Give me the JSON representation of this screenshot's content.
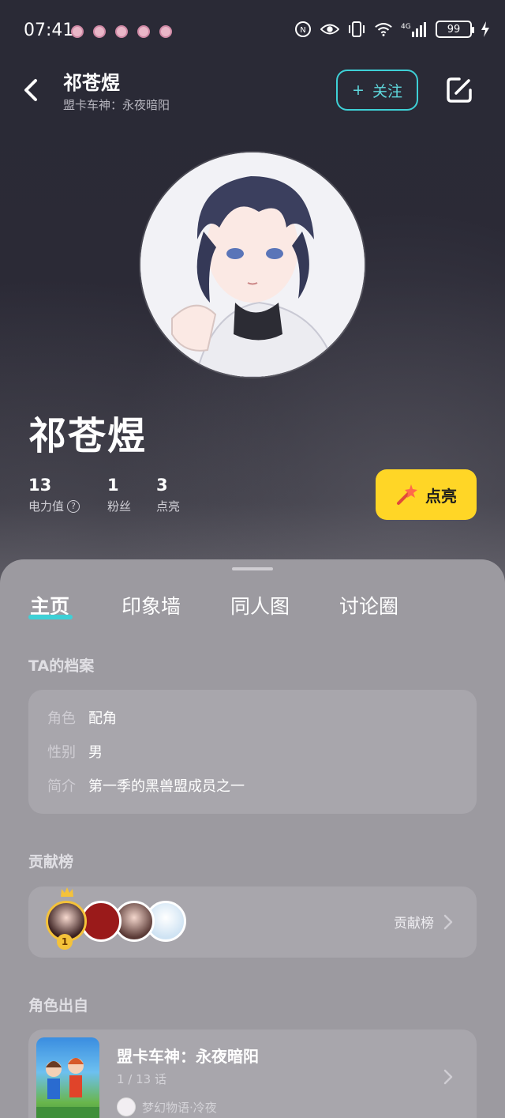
{
  "status_bar": {
    "time": "07:41",
    "battery": "99",
    "network": "4G"
  },
  "header": {
    "title": "祁苍煜",
    "subtitle": "盟卡车神：永夜暗阳",
    "follow_label": "关注",
    "follow_plus": "+"
  },
  "profile": {
    "name": "祁苍煜",
    "stats": [
      {
        "value": "13",
        "label": "电力值"
      },
      {
        "value": "1",
        "label": "粉丝"
      },
      {
        "value": "3",
        "label": "点亮"
      }
    ],
    "light_button": "点亮"
  },
  "tabs": [
    {
      "label": "主页",
      "active": true
    },
    {
      "label": "印象墙",
      "active": false
    },
    {
      "label": "同人图",
      "active": false
    },
    {
      "label": "讨论圈",
      "active": false
    }
  ],
  "archive": {
    "title": "TA的档案",
    "rows": [
      {
        "key": "角色",
        "value": "配角"
      },
      {
        "key": "性别",
        "value": "男"
      },
      {
        "key": "简介",
        "value": "第一季的黑兽盟成员之一"
      }
    ]
  },
  "contribution": {
    "title": "贡献榜",
    "link_label": "贡献榜",
    "rank_badge": "1"
  },
  "origin": {
    "title": "角色出自",
    "work_title": "盟卡车神：永夜暗阳",
    "episode": "1 / 13 话",
    "author": "梦幻物语·冷夜"
  },
  "colors": {
    "accent": "#3ed0d6",
    "light_button": "#ffd626",
    "sheet": "#9c9aa0"
  }
}
